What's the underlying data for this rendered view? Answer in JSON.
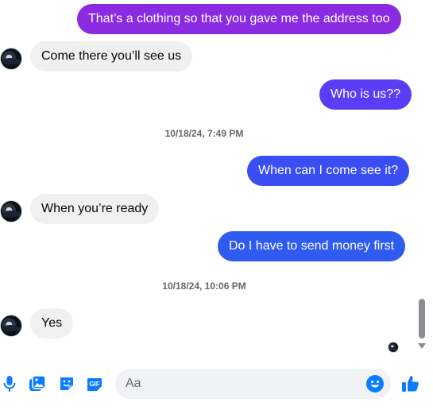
{
  "colors": {
    "outgoing_top": "#8a2be2",
    "outgoing_mid": "#5b3df5",
    "outgoing_low": "#2f5bf0",
    "incoming": "#f0f0f0",
    "accent": "#0a7cff"
  },
  "messages": [
    {
      "direction": "outgoing",
      "text": "That’s a clothing so that you gave me the address too"
    },
    {
      "direction": "incoming",
      "text": "Come there you’ll see us"
    },
    {
      "direction": "outgoing",
      "text": "Who is us??"
    },
    {
      "direction": "timestamp",
      "text": "10/18/24, 7:49 PM"
    },
    {
      "direction": "outgoing",
      "text": "When can I come see it?"
    },
    {
      "direction": "incoming",
      "text": "When you’re ready"
    },
    {
      "direction": "outgoing",
      "text": "Do I have to send money first"
    },
    {
      "direction": "timestamp",
      "text": "10/18/24, 10:06 PM"
    },
    {
      "direction": "incoming",
      "text": "Yes"
    }
  ],
  "composer": {
    "placeholder": "Aa",
    "icons": [
      "microphone-icon",
      "image-icon",
      "sticker-icon",
      "gif-icon",
      "emoji-icon",
      "thumbs-up-icon"
    ],
    "gif_label": "GIF"
  }
}
